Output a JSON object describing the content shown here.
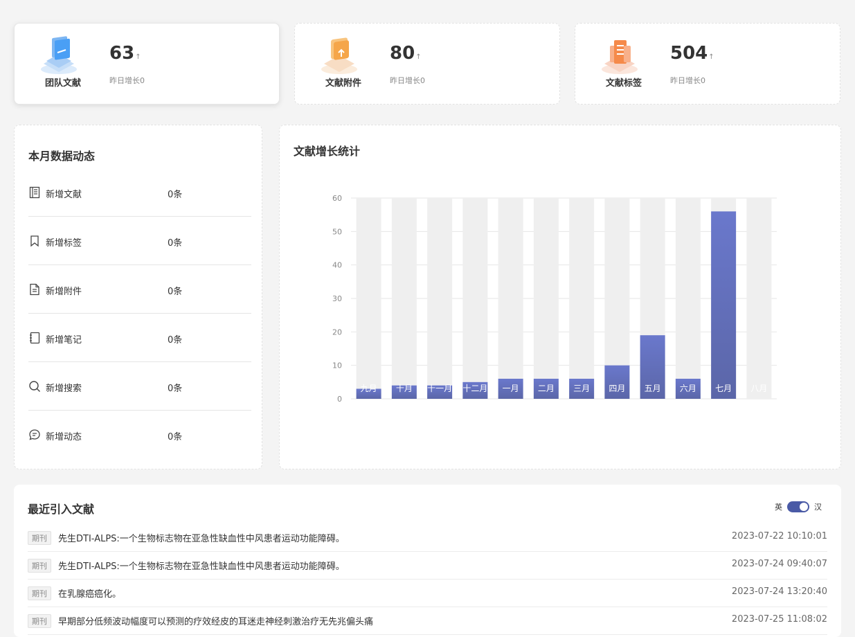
{
  "stats": [
    {
      "label": "团队文献",
      "value": "63",
      "sub": "昨日增长0",
      "icon": "folder-stack-icon",
      "color": "#4a9ff5"
    },
    {
      "label": "文献附件",
      "value": "80",
      "sub": "昨日增长0",
      "icon": "upload-doc-icon",
      "color": "#f5a64a"
    },
    {
      "label": "文献标签",
      "value": "504",
      "sub": "昨日增长0",
      "icon": "tag-building-icon",
      "color": "#f58a4a"
    }
  ],
  "monthly": {
    "title": "本月数据动态",
    "items": [
      {
        "label": "新增文献",
        "value": "0条",
        "icon": "document-list-icon"
      },
      {
        "label": "新增标签",
        "value": "0条",
        "icon": "bookmark-icon"
      },
      {
        "label": "新增附件",
        "value": "0条",
        "icon": "file-icon"
      },
      {
        "label": "新增笔记",
        "value": "0条",
        "icon": "notebook-icon"
      },
      {
        "label": "新增搜索",
        "value": "0条",
        "icon": "search-icon"
      },
      {
        "label": "新增动态",
        "value": "0条",
        "icon": "message-icon"
      }
    ]
  },
  "growth": {
    "title": "文献增长统计"
  },
  "chart_data": {
    "type": "bar",
    "title": "文献增长统计",
    "categories": [
      "九月",
      "十月",
      "十一月",
      "十二月",
      "一月",
      "二月",
      "三月",
      "四月",
      "五月",
      "六月",
      "七月",
      "八月"
    ],
    "values": [
      3,
      4,
      4,
      5,
      6,
      6,
      6,
      10,
      19,
      6,
      56,
      0
    ],
    "ylim": [
      0,
      60
    ],
    "yticks": [
      0,
      10,
      20,
      30,
      40,
      50,
      60
    ],
    "grid": true,
    "bar_color": "#5b66a8",
    "background_bar_color": "#efefef"
  },
  "recent": {
    "title": "最近引入文献",
    "lang_left": "英",
    "lang_right": "汉",
    "rows": [
      {
        "tag": "期刊",
        "title": "先生DTI-ALPS:一个生物标志物在亚急性缺血性中风患者运动功能障碍。",
        "time": "2023-07-22 10:10:01"
      },
      {
        "tag": "期刊",
        "title": "先生DTI-ALPS:一个生物标志物在亚急性缺血性中风患者运动功能障碍。",
        "time": "2023-07-24 09:40:07"
      },
      {
        "tag": "期刊",
        "title": "在乳腺癌癌化。",
        "time": "2023-07-24 13:20:40"
      },
      {
        "tag": "期刊",
        "title": "早期部分低频波动幅度可以预测的疗效经皮的耳迷走神经刺激治疗无先兆偏头痛",
        "time": "2023-07-25 11:08:02"
      }
    ]
  }
}
